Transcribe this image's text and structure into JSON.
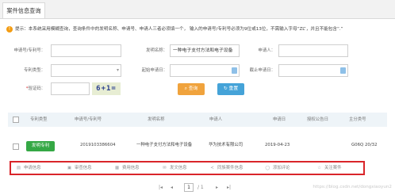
{
  "tab": {
    "label": "案件信息查询"
  },
  "notice": {
    "text": "提示：本系统采用模糊查询，查询条件中的发明名称、申请号、申请人三者必须填一个， 输入的申请号/专利号必须为9位或13位，不需输入字母“ZL”，并且不能包含“.”"
  },
  "form": {
    "app_no_label": "申请号/专利号：",
    "app_no_value": "",
    "title_label": "发明名称：",
    "title_value": "一种电子支付方法和电子设备",
    "applicant_label": "申请人：",
    "applicant_value": "",
    "type_label": "专利类型：",
    "type_value": "",
    "start_date_label": "起始申请日：",
    "start_date_value": "",
    "end_date_label": "截止申请日：",
    "end_date_value": "",
    "captcha_label": "验证码：",
    "captcha_value": "",
    "captcha_image_text": "6+1=",
    "search_button": "查询",
    "reset_button": "重置"
  },
  "table": {
    "headers": [
      "专利类型",
      "申请号/专利号",
      "发明名称",
      "申请人",
      "申请日",
      "授权公告日",
      "主分类号"
    ],
    "row": {
      "type": "发明专利",
      "app_no": "2019103386604",
      "title": "一种电子支付方法和电子设备",
      "applicant": "华为技术有限公司",
      "date": "2019-04-23",
      "grant_date": "",
      "class": "G06Q 20/32"
    }
  },
  "actions": [
    {
      "icon": "document-icon",
      "label": "申请信息"
    },
    {
      "icon": "image-icon",
      "label": "审查信息"
    },
    {
      "icon": "calendar-icon",
      "label": "费用信息"
    },
    {
      "icon": "mail-icon",
      "label": "发文信息"
    },
    {
      "icon": "share-icon",
      "label": "同族案件信息"
    },
    {
      "icon": "comment-icon",
      "label": "添加评论"
    },
    {
      "icon": "star-icon",
      "label": "关注案件"
    }
  ],
  "pager": {
    "current": "1",
    "total": "/ 1"
  },
  "watermark": "https://blog.csdn.net/dongxiaoyun2"
}
